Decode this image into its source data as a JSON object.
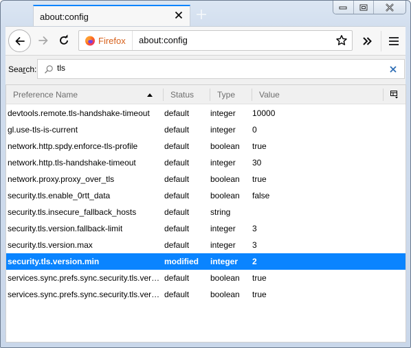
{
  "window": {
    "tab_title": "about:config",
    "controls": [
      "minimize",
      "maximize",
      "close"
    ]
  },
  "navbar": {
    "identity_label": "Firefox",
    "url": "about:config",
    "icons": {
      "back": "arrow-left-icon",
      "forward": "arrow-right-icon",
      "reload": "reload-icon",
      "bookmark": "star-icon",
      "overflow": "double-chevron-icon",
      "menu": "hamburger-icon"
    }
  },
  "search": {
    "label": "Search:",
    "value": "tls",
    "placeholder": ""
  },
  "table": {
    "columns": {
      "name": "Preference Name",
      "status": "Status",
      "type": "Type",
      "value": "Value"
    },
    "sorted_by": "Preference Name",
    "sort_direction": "ascending",
    "rows": [
      {
        "name": "devtools.remote.tls-handshake-timeout",
        "status": "default",
        "type": "integer",
        "value": "10000"
      },
      {
        "name": "gl.use-tls-is-current",
        "status": "default",
        "type": "integer",
        "value": "0"
      },
      {
        "name": "network.http.spdy.enforce-tls-profile",
        "status": "default",
        "type": "boolean",
        "value": "true"
      },
      {
        "name": "network.http.tls-handshake-timeout",
        "status": "default",
        "type": "integer",
        "value": "30"
      },
      {
        "name": "network.proxy.proxy_over_tls",
        "status": "default",
        "type": "boolean",
        "value": "true"
      },
      {
        "name": "security.tls.enable_0rtt_data",
        "status": "default",
        "type": "boolean",
        "value": "false"
      },
      {
        "name": "security.tls.insecure_fallback_hosts",
        "status": "default",
        "type": "string",
        "value": ""
      },
      {
        "name": "security.tls.version.fallback-limit",
        "status": "default",
        "type": "integer",
        "value": "3"
      },
      {
        "name": "security.tls.version.max",
        "status": "default",
        "type": "integer",
        "value": "3"
      },
      {
        "name": "security.tls.version.min",
        "status": "modified",
        "type": "integer",
        "value": "2"
      },
      {
        "name": "services.sync.prefs.sync.security.tls.versi...",
        "status": "default",
        "type": "boolean",
        "value": "true"
      },
      {
        "name": "services.sync.prefs.sync.security.tls.versi...",
        "status": "default",
        "type": "boolean",
        "value": "true"
      }
    ],
    "selected_index": 9
  },
  "colors": {
    "accent": "#0a84ff",
    "firefox_label": "#d7601a"
  }
}
